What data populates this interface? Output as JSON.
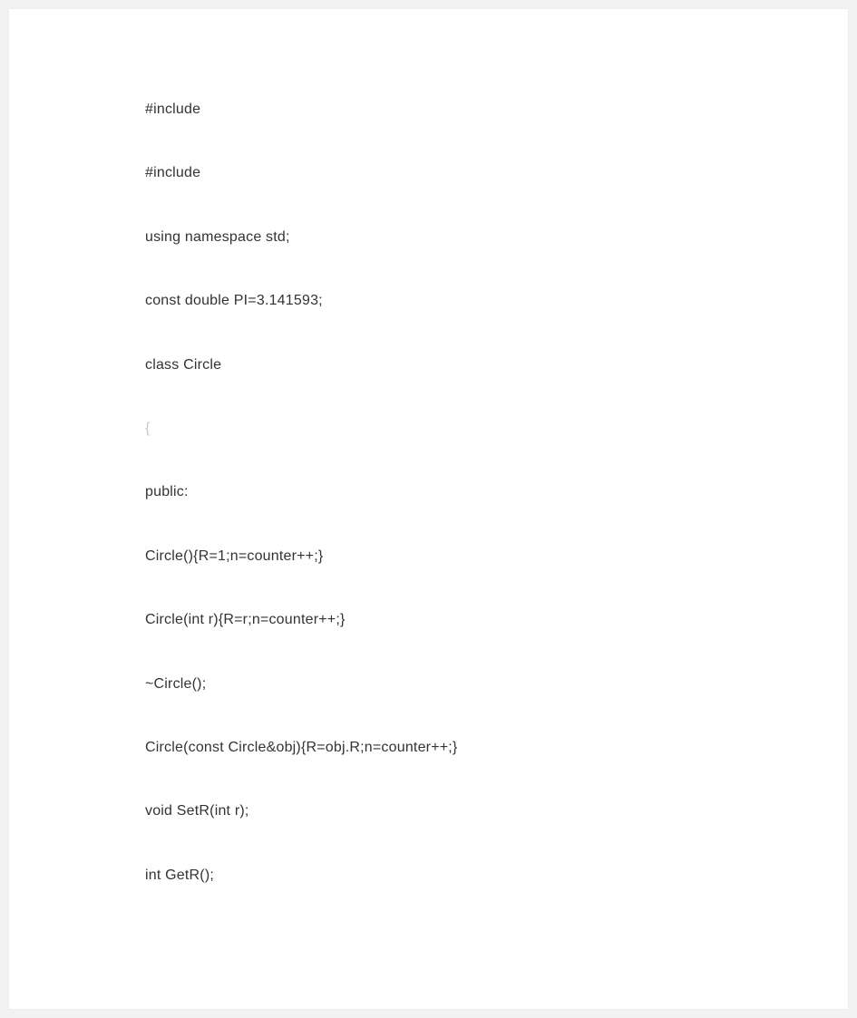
{
  "code": {
    "lines": [
      "#include",
      "#include",
      "using namespace std;",
      "const double PI=3.141593;",
      "class Circle",
      "{",
      "public:",
      "Circle(){R=1;n=counter++;}",
      "Circle(int r){R=r;n=counter++;}",
      "~Circle();",
      "Circle(const Circle&obj){R=obj.R;n=counter++;}",
      "void SetR(int r);",
      "int GetR();"
    ]
  }
}
